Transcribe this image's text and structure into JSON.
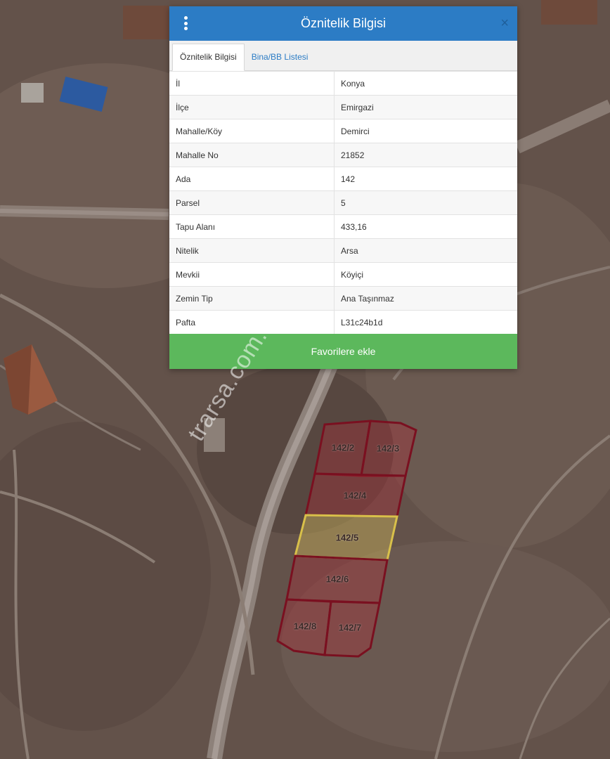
{
  "dialog": {
    "title": "Öznitelik Bilgisi",
    "close_glyph": "×",
    "tabs": [
      {
        "label": "Öznitelik Bilgisi",
        "active": true
      },
      {
        "label": "Bina/BB Listesi",
        "active": false
      }
    ],
    "rows": [
      {
        "key": "İl",
        "value": "Konya"
      },
      {
        "key": "İlçe",
        "value": "Emirgazi"
      },
      {
        "key": "Mahalle/Köy",
        "value": "Demirci"
      },
      {
        "key": "Mahalle No",
        "value": "21852"
      },
      {
        "key": "Ada",
        "value": "142"
      },
      {
        "key": "Parsel",
        "value": "5"
      },
      {
        "key": "Tapu Alanı",
        "value": "433,16"
      },
      {
        "key": "Nitelik",
        "value": "Arsa"
      },
      {
        "key": "Mevkii",
        "value": "Köyiçi"
      },
      {
        "key": "Zemin Tip",
        "value": "Ana Taşınmaz"
      },
      {
        "key": "Pafta",
        "value": "L31c24b1d"
      }
    ],
    "favorite_button": "Favorilere ekle"
  },
  "map": {
    "parcels": [
      "142/2",
      "142/3",
      "142/4",
      "142/5",
      "142/6",
      "142/8",
      "142/7"
    ],
    "selected_parcel": "142/5",
    "colors": {
      "parcel_stroke": "#7a1020",
      "parcel_fill": "#b32b3a",
      "selected_stroke": "#d8c04a",
      "selected_fill": "#c9b25a",
      "header": "#2c7cc5",
      "button": "#5cb85c"
    }
  },
  "watermark": "trarsa.com.tr"
}
